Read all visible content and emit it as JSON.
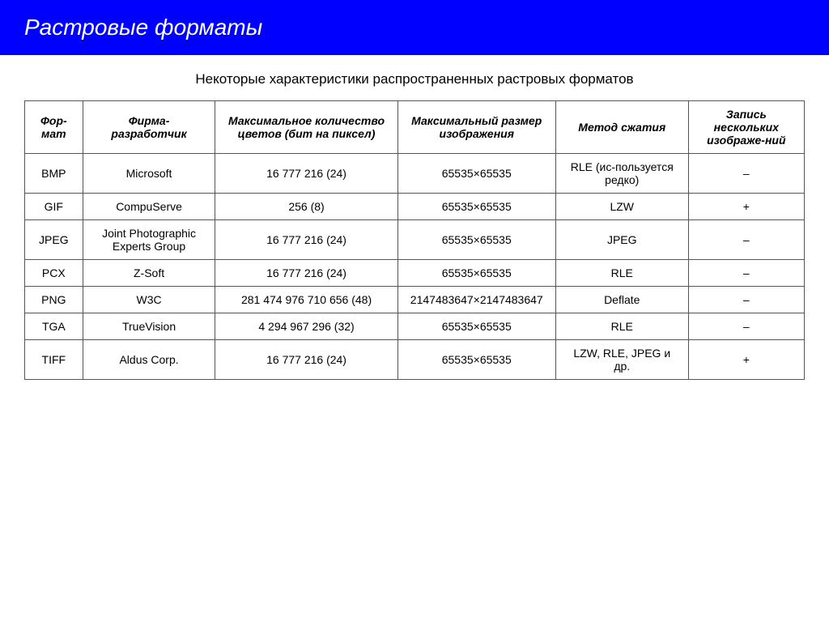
{
  "header": {
    "title": "Растровые форматы",
    "bg_color": "#0000ff"
  },
  "subtitle": "Некоторые характеристики распространенных растровых форматов",
  "table": {
    "columns": [
      {
        "id": "format",
        "label": "Фор-\nмат"
      },
      {
        "id": "company",
        "label": "Фирма-\nразработчик"
      },
      {
        "id": "colors",
        "label": "Максимальное количество цветов (бит на пиксел)"
      },
      {
        "id": "size",
        "label": "Максимальный размер изображения"
      },
      {
        "id": "compress",
        "label": "Метод сжатия"
      },
      {
        "id": "multi",
        "label": "Запись нескольких изображе-ний"
      }
    ],
    "rows": [
      {
        "format": "BMP",
        "company": "Microsoft",
        "colors": "16 777 216 (24)",
        "size": "65535×65535",
        "compress": "RLE (ис-пользуется редко)",
        "multi": "–"
      },
      {
        "format": "GIF",
        "company": "CompuServe",
        "colors": "256 (8)",
        "size": "65535×65535",
        "compress": "LZW",
        "multi": "+"
      },
      {
        "format": "JPEG",
        "company": "Joint Photographic Experts Group",
        "colors": "16 777 216 (24)",
        "size": "65535×65535",
        "compress": "JPEG",
        "multi": "–"
      },
      {
        "format": "PCX",
        "company": "Z-Soft",
        "colors": "16 777 216 (24)",
        "size": "65535×65535",
        "compress": "RLE",
        "multi": "–"
      },
      {
        "format": "PNG",
        "company": "W3C",
        "colors": "281 474 976 710 656 (48)",
        "size": "2147483647×2147483647",
        "compress": "Deflate",
        "multi": "–"
      },
      {
        "format": "TGA",
        "company": "TrueVision",
        "colors": "4 294 967 296 (32)",
        "size": "65535×65535",
        "compress": "RLE",
        "multi": "–"
      },
      {
        "format": "TIFF",
        "company": "Aldus Corp.",
        "colors": "16 777 216 (24)",
        "size": "65535×65535",
        "compress": "LZW, RLE, JPEG и др.",
        "multi": "+"
      }
    ]
  }
}
